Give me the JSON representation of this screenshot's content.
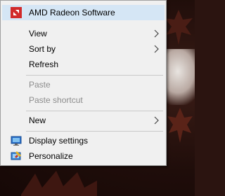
{
  "colors": {
    "menu_background": "#f0f0f0",
    "selected_background": "#d5e6f5",
    "disabled_text": "#8c8c8c",
    "amd_red": "#d12a2a"
  },
  "context_menu": {
    "items": [
      {
        "label": "AMD Radeon Software",
        "icon": "amd-radeon-icon",
        "state": "highlighted"
      },
      {
        "label": "View",
        "submenu": true
      },
      {
        "label": "Sort by",
        "submenu": true
      },
      {
        "label": "Refresh"
      },
      {
        "label": "Paste",
        "state": "disabled"
      },
      {
        "label": "Paste shortcut",
        "state": "disabled"
      },
      {
        "label": "New",
        "submenu": true
      },
      {
        "label": "Display settings",
        "icon": "display-settings-icon"
      },
      {
        "label": "Personalize",
        "icon": "personalize-icon"
      }
    ]
  }
}
